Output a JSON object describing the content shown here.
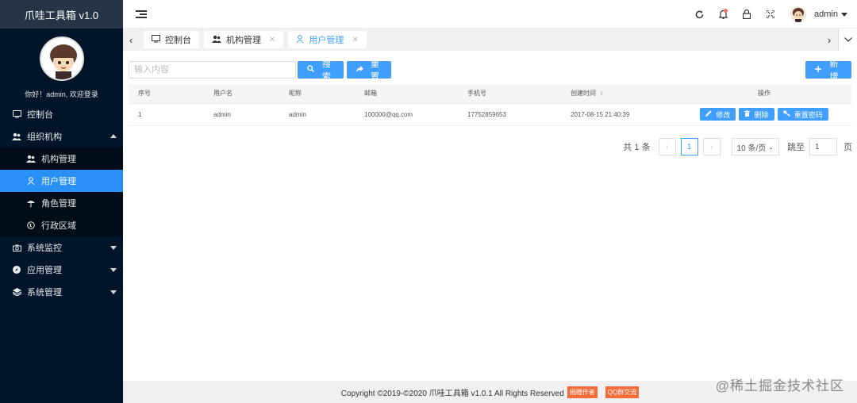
{
  "app": {
    "title": "爪哇工具箱 v1.0"
  },
  "sidebar": {
    "welcome": "你好！admin, 欢迎登录",
    "items": [
      {
        "label": "控制台",
        "icon": "monitor-icon",
        "level": 1
      },
      {
        "label": "组织机构",
        "icon": "users-icon",
        "level": 1,
        "expanded": true
      },
      {
        "label": "机构管理",
        "icon": "team-icon",
        "level": 2
      },
      {
        "label": "用户管理",
        "icon": "user-icon",
        "level": 2,
        "active": true
      },
      {
        "label": "角色管理",
        "icon": "umbrella-icon",
        "level": 2
      },
      {
        "label": "行政区域",
        "icon": "globe-icon",
        "level": 2
      },
      {
        "label": "系统监控",
        "icon": "camera-icon",
        "level": 1
      },
      {
        "label": "应用管理",
        "icon": "compass-icon",
        "level": 1
      },
      {
        "label": "系统管理",
        "icon": "layers-icon",
        "level": 1
      }
    ]
  },
  "header": {
    "username": "admin"
  },
  "tabs": [
    {
      "label": "控制台",
      "icon": "monitor-icon",
      "closable": false,
      "active": false
    },
    {
      "label": "机构管理",
      "icon": "team-icon",
      "closable": true,
      "active": false
    },
    {
      "label": "用户管理",
      "icon": "user-icon",
      "closable": true,
      "active": true
    }
  ],
  "toolbar": {
    "search_placeholder": "输入内容",
    "search_label": "搜索",
    "reset_label": "重置",
    "add_label": "新增"
  },
  "table": {
    "columns": [
      "序号",
      "用户名",
      "昵称",
      "邮箱",
      "手机号",
      "创建时间",
      "操作"
    ],
    "rows": [
      {
        "index": "1",
        "username": "admin",
        "nickname": "admin",
        "email": "100000@qq.com",
        "phone": "17752859653",
        "created": "2017-08-15 21:40:39"
      }
    ],
    "actions": {
      "edit": "修改",
      "delete": "删除",
      "reset_pwd": "重置密码"
    }
  },
  "pagination": {
    "total": "共 1 条",
    "current_page": "1",
    "page_size": "10 条/页",
    "jump_label": "跳至",
    "jump_value": "1",
    "page_unit": "页"
  },
  "footer": {
    "copyright": "Copyright ©2019-©2020 爪哇工具箱 v1.0.1 All Rights Reserved",
    "badge1": "捐赠作者",
    "badge2": "QQ群交流"
  },
  "watermark": "@稀土掘金技术社区",
  "colors": {
    "sidebar_bg": "#001529",
    "accent": "#409eff",
    "active_menu": "#2a8ff7",
    "badge": "#f56b3a"
  }
}
